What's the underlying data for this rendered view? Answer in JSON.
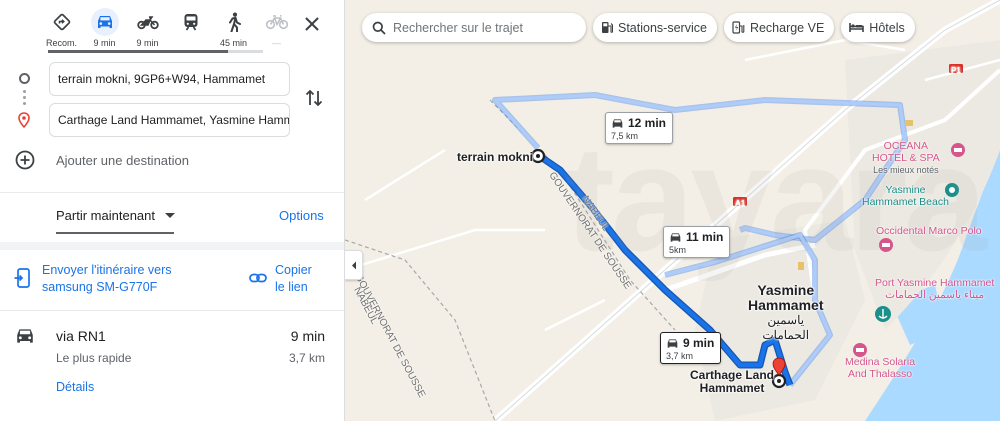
{
  "panel": {
    "modes": [
      {
        "name": "recommended",
        "label": "Recom."
      },
      {
        "name": "car",
        "label": "9 min"
      },
      {
        "name": "motorcycle",
        "label": "9 min"
      },
      {
        "name": "transit",
        "label": ""
      },
      {
        "name": "walk",
        "label": "45 min"
      },
      {
        "name": "bike",
        "label": "—"
      }
    ],
    "origin_value": "terrain mokni, 9GP6+W94, Hammamet",
    "destination_value": "Carthage Land Hammamet, Yasmine Hammamet",
    "add_destination": "Ajouter une destination",
    "depart": "Partir maintenant",
    "options": "Options",
    "send_label": "Envoyer l'itinéraire vers samsung SM-G770F",
    "send_line1": "Envoyer l'itinéraire vers",
    "send_line2": "samsung SM-G770F",
    "copy_line1": "Copier",
    "copy_line2": "le lien",
    "route": {
      "via": "via RN1",
      "duration": "9 min",
      "subtitle": "Le plus rapide",
      "distance": "3,7 km",
      "details": "Détails"
    }
  },
  "map": {
    "search_placeholder": "Rechercher sur le trajet",
    "chips": [
      "Stations-service",
      "Recharge VE",
      "Hôtels"
    ],
    "bubbles": [
      {
        "time": "12 min",
        "dist": "7,5 km"
      },
      {
        "time": "11 min",
        "dist": "5km"
      },
      {
        "time": "9 min",
        "dist": "3,7 km"
      }
    ],
    "places": {
      "origin": "terrain mokni",
      "destination_line1": "Carthage Land",
      "destination_line2": "Hammamet",
      "yasmine_line1": "Yasmine",
      "yasmine_line2": "Hammamet",
      "yasmine_ar_line1": "ياسمين",
      "yasmine_ar_line2": "الحمامات",
      "oceana_line1": "OCEANA",
      "oceana_line2": "HOTEL & SPA",
      "oceana_sub": "Les mieux notés",
      "beach_line1": "Yasmine",
      "beach_line2": "Hammamet Beach",
      "occidental": "Occidental Marco Polo",
      "port_line1": "Port Yasmine Hammamet",
      "port_line2": "ميناء ياسمين الحمامات",
      "medina_line1": "Medina Solaria",
      "medina_line2": "And Thalasso"
    },
    "roads": {
      "a1": "A1",
      "p1": "P1",
      "gouvernorat": "GOUVERNORAT DE SOUSSE",
      "nabeul": "NABEUL",
      "nabeul_left": "NABEUL",
      "sousse_left": "GOUVERNORAT DE SOUSSE"
    },
    "watermark": "tayara",
    "colors": {
      "route_main": "#1a73e8",
      "route_alt": "#aecbfa",
      "water": "#aadaff",
      "land": "#f3efe6",
      "hotel_pink": "#d5568b",
      "poi_teal": "#1a8f8b"
    }
  }
}
